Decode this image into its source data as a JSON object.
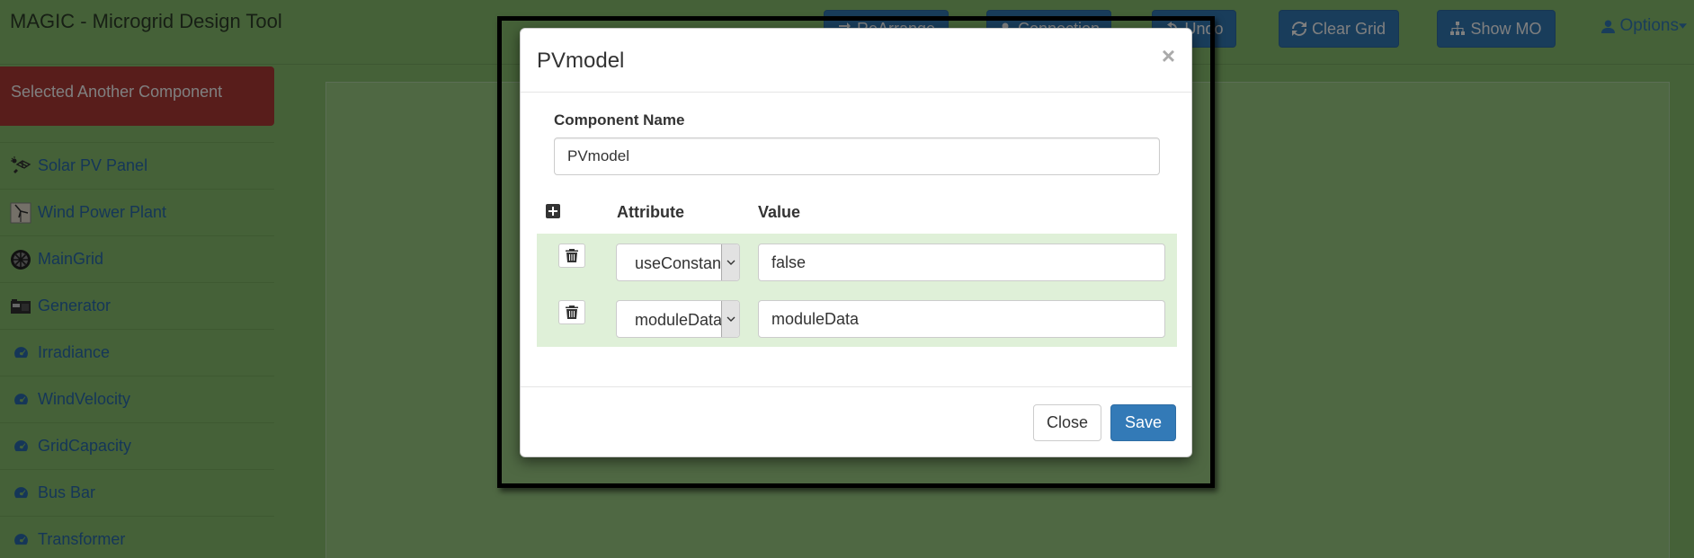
{
  "app": {
    "title": "MAGIC - Microgrid Design Tool"
  },
  "toolbar": {
    "rearrange_label": "ReArrange",
    "connection_label": "Connection",
    "undo_label": "Undo",
    "clear_grid_label": "Clear Grid",
    "show_mo_label": "Show MO",
    "options_label": "Options"
  },
  "sidebar": {
    "alert": "Selected Another Component",
    "items": [
      {
        "label": "Solar PV Panel",
        "icon": "solar-panel-icon"
      },
      {
        "label": "Wind Power Plant",
        "icon": "wind-turbine-icon"
      },
      {
        "label": "MainGrid",
        "icon": "main-grid-icon"
      },
      {
        "label": "Generator",
        "icon": "generator-icon"
      },
      {
        "label": "Irradiance",
        "icon": "dashboard-icon"
      },
      {
        "label": "WindVelocity",
        "icon": "dashboard-icon"
      },
      {
        "label": "GridCapacity",
        "icon": "dashboard-icon"
      },
      {
        "label": "Bus Bar",
        "icon": "dashboard-icon"
      },
      {
        "label": "Transformer",
        "icon": "dashboard-icon"
      }
    ]
  },
  "modal": {
    "title": "PVmodel",
    "close_symbol": "×",
    "component_name_label": "Component Name",
    "component_name_value": "PVmodel",
    "headers": {
      "attribute": "Attribute",
      "value": "Value"
    },
    "rows": [
      {
        "attribute": "useConstantPower",
        "value": "false"
      },
      {
        "attribute": "moduleData",
        "value": "moduleData"
      }
    ],
    "close_button": "Close",
    "save_button": "Save"
  },
  "colors": {
    "navbar_bg": "#8bc371",
    "primary": "#337ab7",
    "alert_bg": "#b13a37",
    "row_bg": "#dff0d8"
  }
}
